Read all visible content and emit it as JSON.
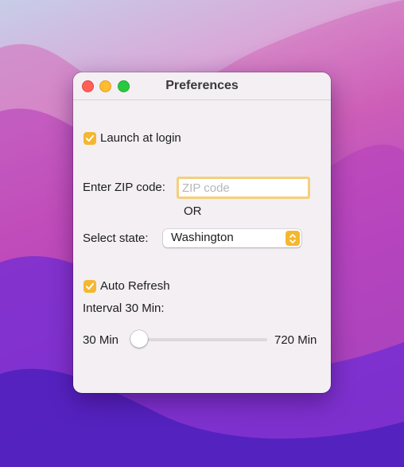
{
  "window": {
    "title": "Preferences"
  },
  "launch_at_login": {
    "label": "Launch at login",
    "checked": true
  },
  "zip": {
    "label": "Enter ZIP code:",
    "placeholder": "ZIP code",
    "value": ""
  },
  "or_label": "OR",
  "state": {
    "label": "Select state:",
    "selected": "Washington"
  },
  "auto_refresh": {
    "label": "Auto Refresh",
    "checked": true
  },
  "interval": {
    "label": "Interval 30 Min:",
    "min_label": "30 Min",
    "max_label": "720 Min",
    "value": 30,
    "min": 30,
    "max": 720
  },
  "colors": {
    "accent": "#f5b730",
    "focus_ring": "#f4cf7c",
    "window_bg": "#f3eff3"
  }
}
